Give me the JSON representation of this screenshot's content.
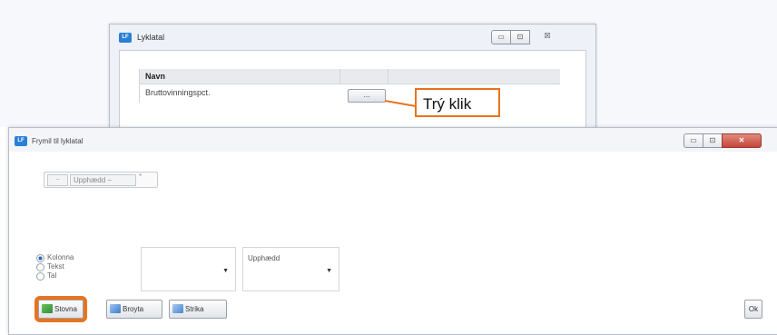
{
  "back_window": {
    "title": "Lyklatal",
    "app_icon": "LF",
    "controls": {
      "minimize": "▭",
      "maximize": "⊡",
      "close": "☒"
    },
    "grid": {
      "columns": [
        "Navn",
        "",
        ""
      ],
      "rows": [
        {
          "name": "Bruttovinningspct.",
          "button": "..."
        }
      ]
    }
  },
  "callout": {
    "text": "Trý klik",
    "color": "#e8731f"
  },
  "dialog": {
    "title": "Frymil til lyklatal",
    "app_icon": "LF",
    "controls": {
      "minimize": "▭",
      "maximize": "⊡",
      "close": "✕"
    },
    "expression": {
      "seg1": "−",
      "seg2": "Upphædd −",
      "seg3": "*"
    },
    "radio_options": [
      {
        "label": "Kolonna",
        "selected": true
      },
      {
        "label": "Tekst",
        "selected": false
      },
      {
        "label": "Tal",
        "selected": false
      }
    ],
    "combo1": {
      "value": ""
    },
    "combo2": {
      "value": "Upphædd"
    },
    "buttons": {
      "stovna": "Stovna",
      "broyta": "Broyta",
      "strika": "Strika",
      "ok": "Ok"
    }
  }
}
